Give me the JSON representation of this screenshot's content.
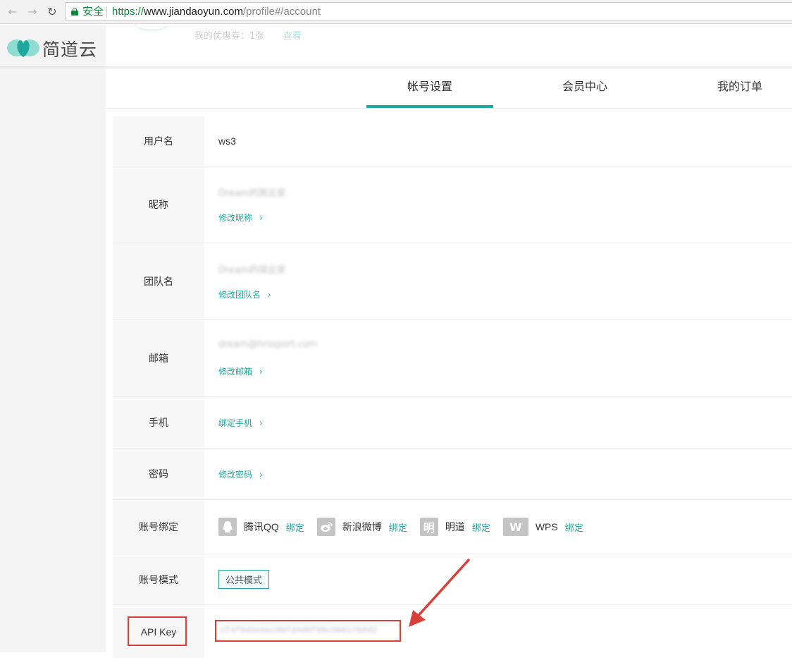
{
  "browser": {
    "secure_label": "安全",
    "url_scheme": "https://",
    "url_host": "www.jiandaoyun.com",
    "url_path": "/profile#/account"
  },
  "brand": {
    "logo_text": "简道云",
    "accent": "#1fa89d"
  },
  "header": {
    "coupon_text": "我的优惠券：1张",
    "coupon_link": "查看"
  },
  "tabs": [
    {
      "label": "帐号设置",
      "active": true
    },
    {
      "label": "会员中心",
      "active": false
    },
    {
      "label": "我的订单",
      "active": false
    }
  ],
  "form": {
    "username": {
      "label": "用户名",
      "value": "ws3"
    },
    "nickname": {
      "label": "昵称",
      "value": "Dream的简云家",
      "action": "修改昵称"
    },
    "team": {
      "label": "团队名",
      "value": "Dream的简云家",
      "action": "修改团队名"
    },
    "email": {
      "label": "邮箱",
      "value": "dream@hrssport.com",
      "action": "修改邮箱"
    },
    "phone": {
      "label": "手机",
      "action": "绑定手机"
    },
    "password": {
      "label": "密码",
      "action": "修改密码"
    },
    "binding": {
      "label": "账号绑定",
      "items": [
        {
          "name": "腾讯QQ",
          "action": "绑定",
          "icon": "qq-icon",
          "glyph": ""
        },
        {
          "name": "新浪微博",
          "action": "绑定",
          "icon": "weibo-icon",
          "glyph": ""
        },
        {
          "name": "明道",
          "action": "绑定",
          "icon": "mingdao-icon",
          "glyph": "明"
        },
        {
          "name": "WPS",
          "action": "绑定",
          "icon": "wps-icon",
          "glyph": "W"
        }
      ]
    },
    "mode": {
      "label": "账号模式",
      "value": "公共模式"
    },
    "apikey": {
      "label": "API Key",
      "value": "1f4f9d2eeec08fd4d9f99c5b017b0d2"
    }
  }
}
